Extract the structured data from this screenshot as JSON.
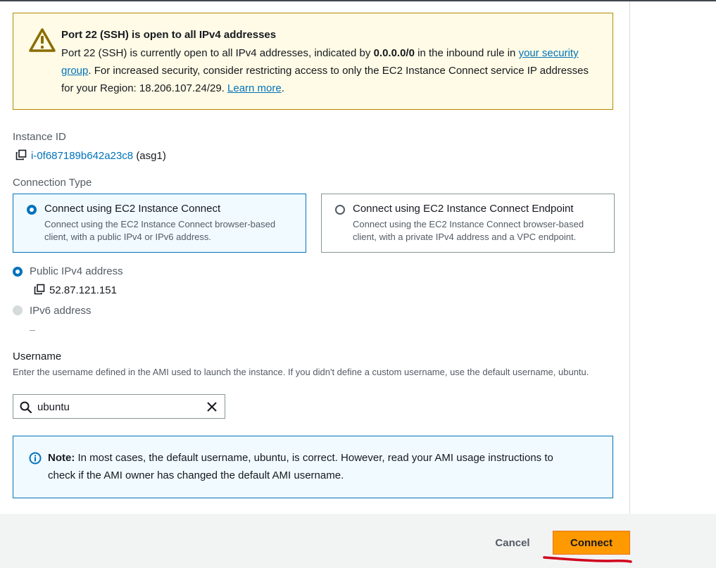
{
  "warning": {
    "title": "Port 22 (SSH) is open to all IPv4 addresses",
    "text_before": "Port 22 (SSH) is currently open to all IPv4 addresses, indicated by ",
    "cidr": "0.0.0.0/0",
    "text_mid": " in the inbound rule in ",
    "sg_link": "your security group",
    "text_after": ". For increased security, consider restricting access to only the EC2 Instance Connect service IP addresses for your Region: 18.206.107.24/29. ",
    "learn_more": "Learn more",
    "end": "."
  },
  "instance": {
    "label": "Instance ID",
    "id": "i-0f687189b642a23c8",
    "name": "(asg1)"
  },
  "connection_type": {
    "label": "Connection Type",
    "options": [
      {
        "title": "Connect using EC2 Instance Connect",
        "desc": "Connect using the EC2 Instance Connect browser-based client, with a public IPv4 or IPv6 address.",
        "selected": true
      },
      {
        "title": "Connect using EC2 Instance Connect Endpoint",
        "desc": "Connect using the EC2 Instance Connect browser-based client, with a private IPv4 address and a VPC endpoint.",
        "selected": false
      }
    ]
  },
  "address": {
    "public_label": "Public IPv4 address",
    "public_ip": "52.87.121.151",
    "ipv6_label": "IPv6 address",
    "ipv6_value": "–"
  },
  "username": {
    "title": "Username",
    "help": "Enter the username defined in the AMI used to launch the instance. If you didn't define a custom username, use the default username, ubuntu.",
    "value": "ubuntu"
  },
  "note": {
    "bold": "Note:",
    "text": " In most cases, the default username, ubuntu, is correct. However, read your AMI usage instructions to check if the AMI owner has changed the default AMI username."
  },
  "footer": {
    "cancel_label": "Cancel",
    "connect_label": "Connect"
  },
  "colors": {
    "accent": "#0073bb",
    "warning_border": "#b38a00",
    "warning_bg": "#fffbe6",
    "primary_button": "#ff9900",
    "annotation": "#d0021b"
  },
  "icons": [
    "warning-icon",
    "copy-icon",
    "search-icon",
    "clear-icon",
    "info-icon"
  ]
}
